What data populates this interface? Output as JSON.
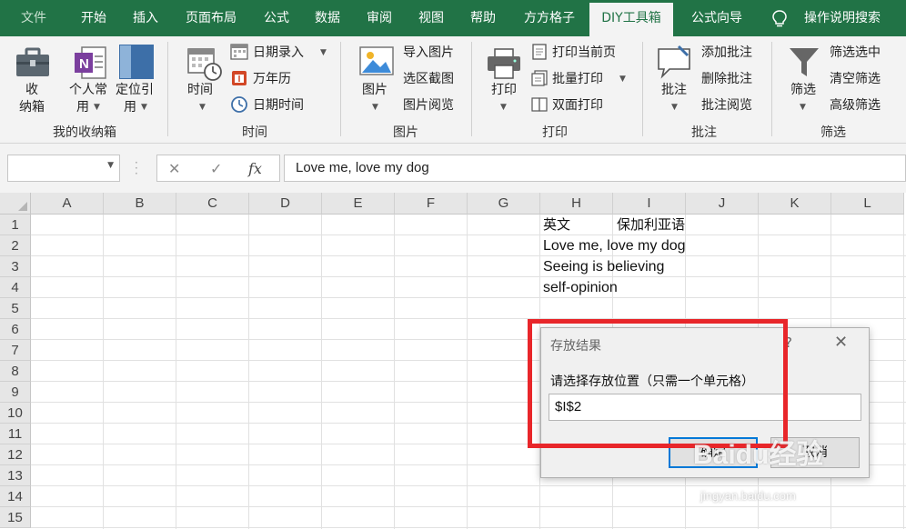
{
  "tabs": [
    {
      "label": "文件"
    },
    {
      "label": "开始"
    },
    {
      "label": "插入"
    },
    {
      "label": "页面布局"
    },
    {
      "label": "公式"
    },
    {
      "label": "数据"
    },
    {
      "label": "审阅"
    },
    {
      "label": "视图"
    },
    {
      "label": "帮助"
    },
    {
      "label": "方方格子"
    },
    {
      "label": "DIY工具箱"
    },
    {
      "label": "公式向导"
    },
    {
      "label": "操作说明搜索"
    }
  ],
  "ribbon": {
    "box": {
      "line1": "收",
      "line2": "纳箱",
      "personal1": "个人常",
      "personal2": "用",
      "locate1": "定位引",
      "locate2": "用",
      "group": "我的收纳箱"
    },
    "time": {
      "big": "时间",
      "date_entry": "日期录入",
      "calendar": "万年历",
      "datetime": "日期时间",
      "group": "时间"
    },
    "image": {
      "big": "图片",
      "import": "导入图片",
      "capture": "选区截图",
      "browse": "图片阅览",
      "group": "图片"
    },
    "print": {
      "big": "打印",
      "current": "打印当前页",
      "batch": "批量打印",
      "duplex": "双面打印",
      "group": "打印"
    },
    "comment": {
      "big": "批注",
      "add": "添加批注",
      "delete": "删除批注",
      "browse": "批注阅览",
      "group": "批注"
    },
    "filter": {
      "big": "筛选",
      "selected": "筛选选中",
      "clear": "清空筛选",
      "advanced": "高级筛选",
      "group": "筛选"
    }
  },
  "formula_bar": {
    "fx": "fx",
    "cancel": "✕",
    "confirm": "✓",
    "value": "Love me, love my dog"
  },
  "grid": {
    "columns": [
      "A",
      "B",
      "C",
      "D",
      "E",
      "F",
      "G",
      "H",
      "I",
      "J",
      "K",
      "L"
    ],
    "rows": [
      "1",
      "2",
      "3",
      "4",
      "5",
      "6",
      "7",
      "8",
      "9",
      "10",
      "11",
      "12",
      "13",
      "14",
      "15"
    ],
    "cells": {
      "h1": "英文",
      "i1": "保加利亚语",
      "h2": "Love me, love my dog",
      "h3": "Seeing is believing",
      "h4": "self-opinion"
    }
  },
  "dialog": {
    "title": "存放结果",
    "help": "?",
    "close": "✕",
    "prompt": "请选择存放位置（只需一个单元格）",
    "value": "$I$2",
    "ok": "确定",
    "cancel": "取消"
  },
  "watermark": {
    "brand": "Baidu经验",
    "url": "jingyan.baidu.com"
  },
  "colors": {
    "excel_green": "#217346",
    "highlight_red": "#e8262a",
    "focus_blue": "#0078d7"
  }
}
